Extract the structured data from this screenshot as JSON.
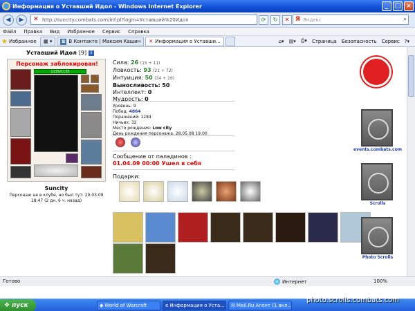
{
  "window": {
    "title": "Информация о Уставший Идол - Windows Internet Explorer"
  },
  "address": {
    "url": "http://suncity.combats.com/inf.pl?login=Уставший%20Идол"
  },
  "search": {
    "placeholder": "Яндекс",
    "brand": "Я"
  },
  "menu": [
    "Файл",
    "Правка",
    "Вид",
    "Избранное",
    "Сервис",
    "Справка"
  ],
  "linkbar": {
    "favorites_label": "Избранное"
  },
  "tabs": [
    {
      "label": "В Контакте | Максим Кашин"
    },
    {
      "label": "Информация о Уставши..."
    }
  ],
  "commands": [
    "Страница",
    "Безопасность",
    "Сервис"
  ],
  "character": {
    "name": "Уставший Идол",
    "level": "[9]",
    "blocked_text": "Персонаж заблокирован!",
    "hp": "1135/1135",
    "city": "Suncity",
    "note": "Персонаж не в клубе, но был тут: 29.03.09 18:47 (2 дн. 6 ч. назад)"
  },
  "stats": [
    {
      "label": "Сила:",
      "value": "26",
      "extra": "(15 + 11)"
    },
    {
      "label": "Ловкость:",
      "value": "93",
      "extra": "(21 + 72)"
    },
    {
      "label": "Интуиция:",
      "value": "50",
      "extra": "(34 + 16)"
    },
    {
      "label": "Выносливость:",
      "value": "50",
      "extra": ""
    },
    {
      "label": "Интеллект:",
      "value": "0",
      "extra": ""
    },
    {
      "label": "Мудрость:",
      "value": "0",
      "extra": ""
    }
  ],
  "info": [
    {
      "label": "Уровень:",
      "value": "9"
    },
    {
      "label": "Побед:",
      "value": "4864"
    },
    {
      "label": "Поражений:",
      "value": "1284"
    },
    {
      "label": "Ничьих:",
      "value": "32"
    },
    {
      "label": "Место рождения:",
      "value": "Low city"
    },
    {
      "label": "День рождения персонажа:",
      "value": "28.05.08 19:00"
    }
  ],
  "message": {
    "title": "Сообщение от паладинов :",
    "text": "01.04.09 00:00 Ушел в себя"
  },
  "gifts_label": "Подарки:",
  "right_links": [
    {
      "label": "events.combats.com"
    },
    {
      "label": "Scrolls"
    },
    {
      "label": "Photo Scrolls"
    }
  ],
  "statusbar": {
    "ready": "Готово",
    "zone": "Интернет",
    "zoom": "100%"
  },
  "taskbar": {
    "start": "пуск",
    "items": [
      "World of Warcraft",
      "Информация о Уста...",
      "Mail.Ru Агент (1 вкл..."
    ],
    "tray": "photo.scrolls.combats.com"
  },
  "colors": {
    "accent": "#1d3aa7",
    "alert": "#e00000",
    "stat_value": "#2a7a2a"
  }
}
